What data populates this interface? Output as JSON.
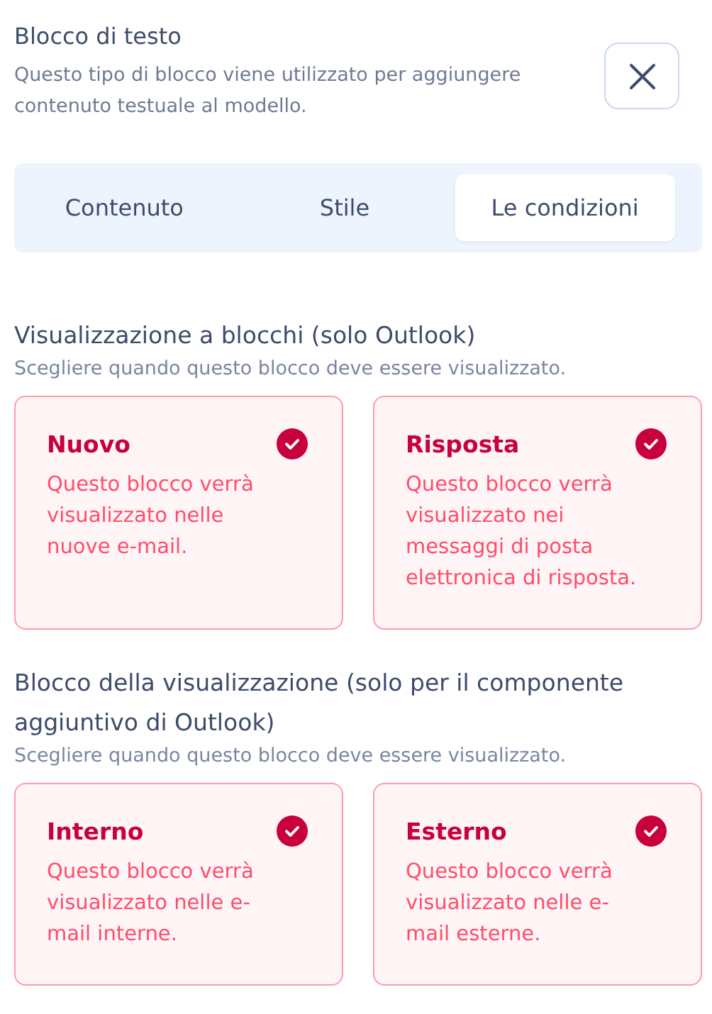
{
  "header": {
    "title": "Blocco di testo",
    "description": "Questo tipo di blocco viene utilizzato per aggiungere contenuto testuale al modello."
  },
  "tabs": [
    {
      "label": "Contenuto",
      "selected": false
    },
    {
      "label": "Stile",
      "selected": false
    },
    {
      "label": "Le condizioni",
      "selected": true
    }
  ],
  "sections": [
    {
      "title": "Visualizzazione a blocchi (solo Outlook)",
      "hint": "Scegliere quando questo blocco deve essere visualizzato.",
      "options": [
        {
          "title": "Nuovo",
          "description": "Questo blocco verrà visualizzato nelle nuove e-mail.",
          "checked": true
        },
        {
          "title": "Risposta",
          "description": "Questo blocco verrà visualizzato nei messaggi di posta elettronica di risposta.",
          "checked": true
        }
      ]
    },
    {
      "title": "Blocco della visualizzazione (solo per il componente aggiuntivo di Outlook)",
      "hint": "Scegliere quando questo blocco deve essere visualizzato.",
      "options": [
        {
          "title": "Interno",
          "description": "Questo blocco verrà visualizzato nelle e-mail interne.",
          "checked": true
        },
        {
          "title": "Esterno",
          "description": "Questo blocco verrà visualizzato nelle e-mail esterne.",
          "checked": true
        }
      ]
    }
  ]
}
